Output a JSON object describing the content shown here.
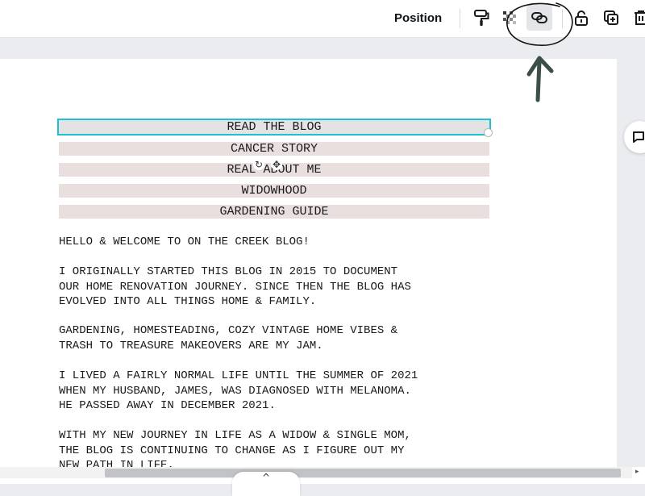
{
  "toolbar": {
    "position_label": "Position",
    "tools": [
      "paint-format-icon",
      "transparency-icon",
      "link-icon",
      "lock-icon",
      "duplicate-icon",
      "delete-icon"
    ],
    "active_tool": "link-icon"
  },
  "nav_menu": {
    "items": [
      "READ THE BLOG",
      "CANCER STORY",
      "REAL ABOUT ME",
      "WIDOWHOOD",
      "GARDENING GUIDE"
    ],
    "selected_index": 0
  },
  "body": {
    "paragraphs": [
      "HELLO & WELCOME TO ON THE CREEK BLOG!",
      "I ORIGINALLY STARTED THIS BLOG IN 2015 TO DOCUMENT\nOUR HOME RENOVATION JOURNEY. SINCE THEN THE BLOG HAS\nEVOLVED INTO ALL THINGS HOME & FAMILY.",
      "GARDENING, HOMESTEADING, COZY VINTAGE HOME VIBES &\nTRASH TO TREASURE MAKEOVERS ARE MY JAM.",
      "I LIVED A FAIRLY NORMAL LIFE UNTIL THE SUMMER OF 2021\nWHEN MY HUSBAND, JAMES, WAS DIAGNOSED WITH MELANOMA.\nHE PASSED AWAY IN DECEMBER 2021.",
      "WITH MY NEW JOURNEY IN LIFE AS A WIDOW & SINGLE MOM,\nTHE BLOG IS CONTINUING TO CHANGE AS I FIGURE OUT MY\nNEW PATH IN LIFE."
    ]
  },
  "selection_controls": {
    "rotate_glyph": "↻",
    "move_glyph": "✥"
  },
  "scroll": {
    "expand_glyph": "^",
    "right_arrow": "▸"
  },
  "colors": {
    "selection_outline": "#1ec1d4",
    "nav_bg": "#e9dfdf",
    "annotation": "#3d5047"
  }
}
